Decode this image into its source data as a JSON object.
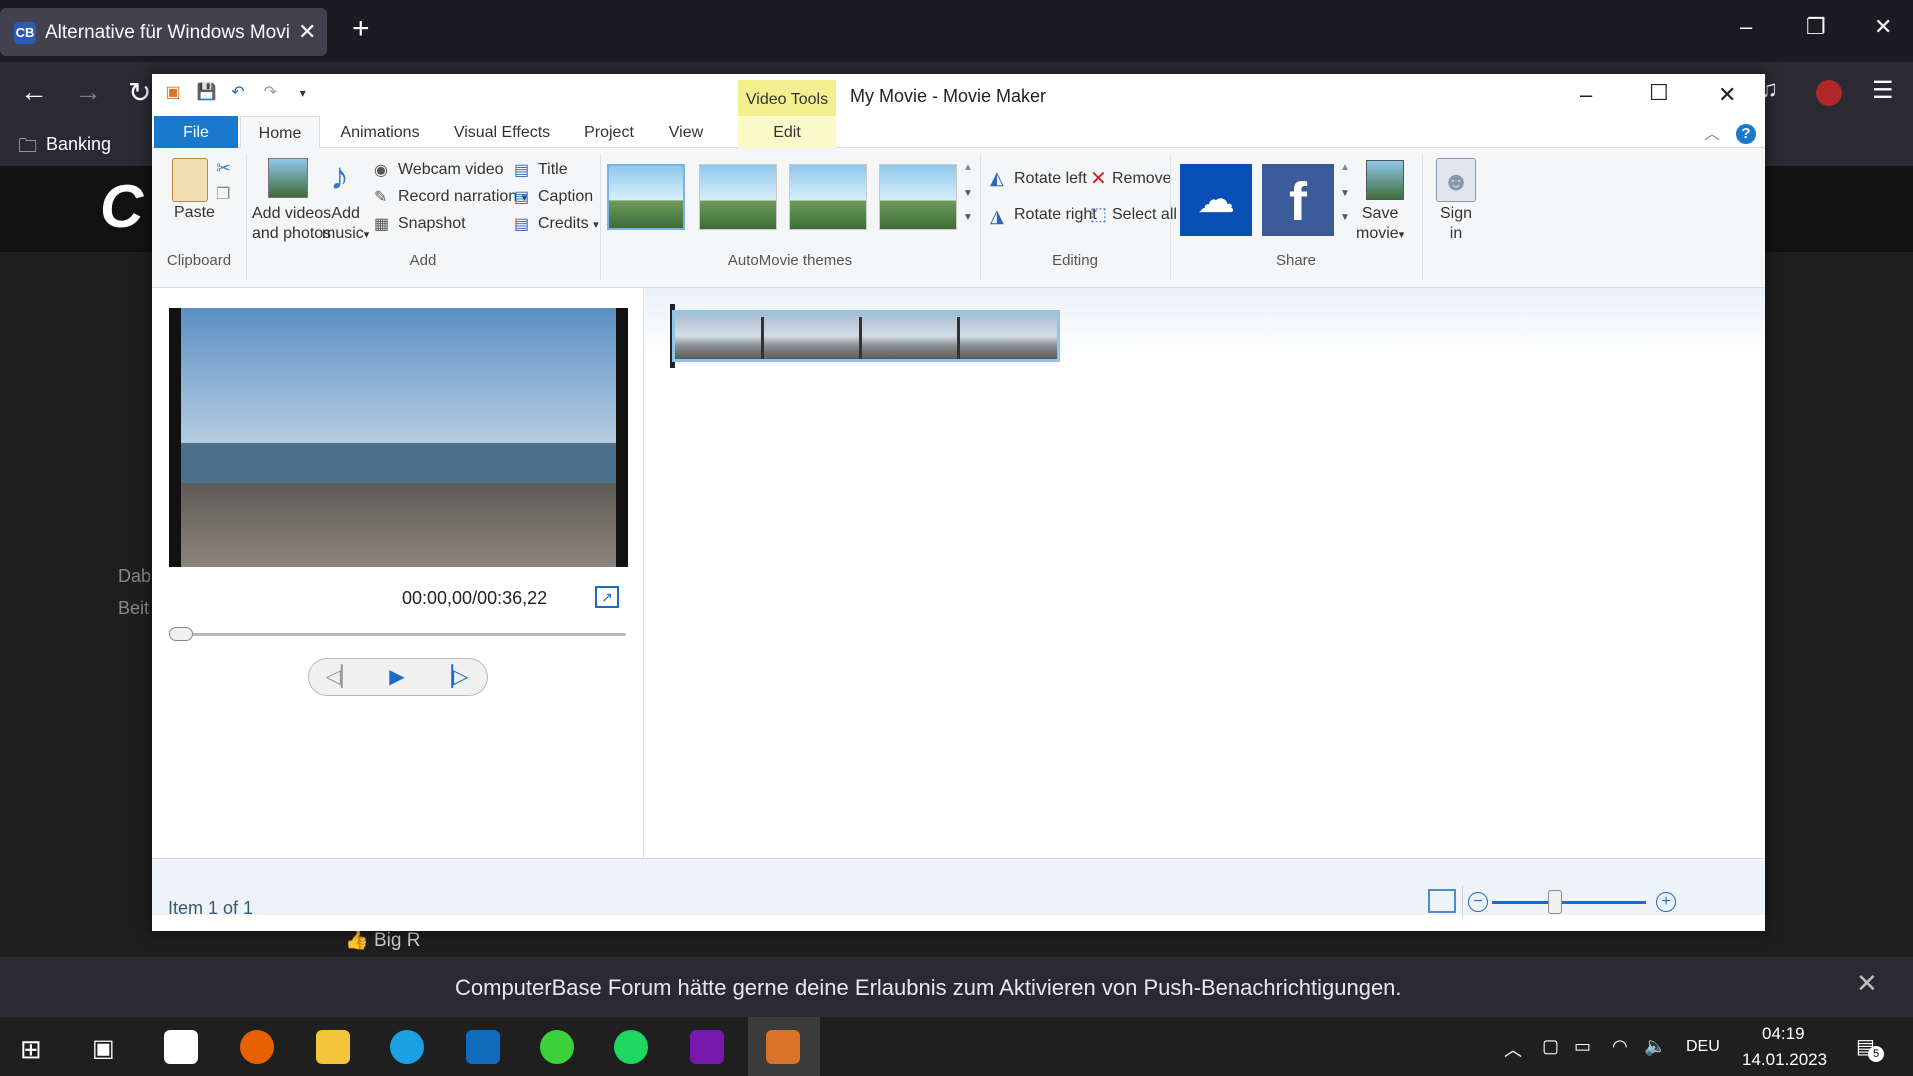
{
  "browser": {
    "tab_title": "Alternative für Windows Movie Maker",
    "tab_favicon": "CB",
    "new_tab": "+",
    "bookmarks": [
      "Banking"
    ]
  },
  "webpage": {
    "logo_text": "C",
    "side_text": [
      "Dab",
      "Beit"
    ],
    "forum_post": "Big R",
    "push_notification": "ComputerBase Forum hätte gerne deine Erlaubnis zum Aktivieren von Push-Benachrichtigungen."
  },
  "app": {
    "title": "My Movie - Movie Maker",
    "contextual_tab_group": "Video Tools",
    "tabs": [
      {
        "label": "File"
      },
      {
        "label": "Home"
      },
      {
        "label": "Animations"
      },
      {
        "label": "Visual Effects"
      },
      {
        "label": "Project"
      },
      {
        "label": "View"
      },
      {
        "label": "Edit"
      }
    ],
    "help": "?"
  },
  "ribbon": {
    "clipboard": {
      "label": "Clipboard",
      "paste": "Paste"
    },
    "add": {
      "label": "Add",
      "add_videos": [
        "Add videos",
        "and photos"
      ],
      "add_music": [
        "Add",
        "music"
      ],
      "webcam_video": "Webcam video",
      "record_narration": "Record narration",
      "snapshot": "Snapshot",
      "title": "Title",
      "caption": "Caption",
      "credits": "Credits"
    },
    "themes": {
      "label": "AutoMovie themes",
      "count": 4,
      "selected_index": 0
    },
    "editing": {
      "label": "Editing",
      "rotate_left": "Rotate left",
      "rotate_right": "Rotate right",
      "remove": "Remove",
      "select_all": "Select all"
    },
    "share": {
      "label": "Share",
      "services": [
        "onedrive-icon",
        "facebook-icon"
      ],
      "save_movie": [
        "Save",
        "movie"
      ],
      "sign_in": [
        "Sign",
        "in"
      ]
    }
  },
  "preview": {
    "timecode": "00:00,00/00:36,22",
    "progress": 0
  },
  "status": {
    "item_text": "Item 1 of 1",
    "zoom_level": 0.4
  },
  "taskbar": {
    "time": "04:19",
    "date": "14.01.2023",
    "language": "DEU",
    "notifications": "5",
    "apps": [
      "start-icon",
      "task-view-icon",
      "store-icon",
      "firefox-icon",
      "explorer-icon",
      "edge-icon",
      "outlook-icon",
      "app-green-icon",
      "spotify-icon",
      "onenote-icon",
      "movie-maker-icon"
    ]
  },
  "colors": {
    "accent": "#1979ca",
    "contextual": "#f2ef8f",
    "selection": "#8ec6ea"
  }
}
